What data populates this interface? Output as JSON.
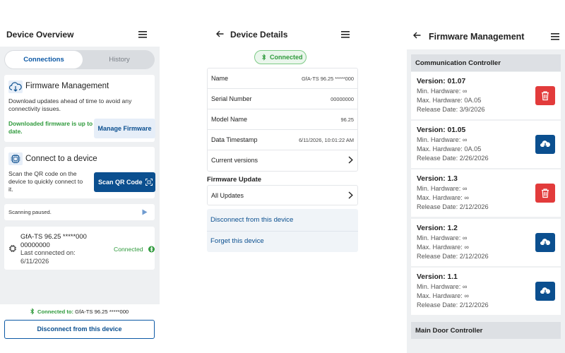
{
  "screen1": {
    "title": "Device Overview",
    "menu_icon": "hamburger-menu-icon",
    "tabs": [
      {
        "label": "Connections",
        "active": true
      },
      {
        "label": "History",
        "active": false
      }
    ],
    "firmware_card": {
      "icon": "cloud-download-icon",
      "title": "Firmware Management",
      "description": "Download updates ahead of time to avoid any connectivity issues.",
      "status": "Downloaded firmware is up to date.",
      "button": "Manage Firmware"
    },
    "connect_card": {
      "icon": "chip-icon",
      "title": "Connect to a device",
      "description": "Scan the QR code on the device to quickly connect to it.",
      "button": "Scan QR Code"
    },
    "scanning": {
      "text": "Scanning paused.",
      "icon": "play-icon"
    },
    "device": {
      "name": "GfA-TS 96.25 *****000",
      "serial": "00000000",
      "last_connected": "Last connected on: 6/11/2026",
      "status": "Connected"
    },
    "footer": {
      "connected_label": "Connected to:",
      "connected_device": "GfA-TS 96.25 *****000",
      "button": "Disconnect from this device"
    }
  },
  "screen2": {
    "title": "Device Details",
    "status_pill": "Connected",
    "rows": [
      {
        "label": "Name",
        "value": "GfA-TS 96.25 *****000"
      },
      {
        "label": "Serial Number",
        "value": "00000000"
      },
      {
        "label": "Model Name",
        "value": "96.25"
      },
      {
        "label": "Data Timestamp",
        "value": "6/11/2026, 10:01:22 AM"
      },
      {
        "label": "Current versions",
        "value": ""
      }
    ],
    "firmware_section": "Firmware Update",
    "all_updates": "All Updates",
    "actions": {
      "disconnect": "Disconnect from this device",
      "forget": "Forget this device"
    }
  },
  "screen3": {
    "title": "Firmware Management",
    "groups": [
      {
        "name": "Communication Controller",
        "versions": [
          {
            "version": "Version: 01.07",
            "min": "Min. Hardware: ∞",
            "max": "Max. Hardware: 0A.05",
            "date": "Release Date: 3/9/2026",
            "action": "delete"
          },
          {
            "version": "Version: 01.05",
            "min": "Min. Hardware: ∞",
            "max": "Max. Hardware: 0A.05",
            "date": "Release Date: 2/26/2026",
            "action": "download"
          },
          {
            "version": "Version: 1.3",
            "min": "Min. Hardware: ∞",
            "max": "Max. Hardware: ∞",
            "date": "Release Date: 2/12/2026",
            "action": "delete"
          },
          {
            "version": "Version: 1.2",
            "min": "Min. Hardware: ∞",
            "max": "Max. Hardware: ∞",
            "date": "Release Date: 2/12/2026",
            "action": "download"
          },
          {
            "version": "Version: 1.1",
            "min": "Min. Hardware: ∞",
            "max": "Max. Hardware: ∞",
            "date": "Release Date: 2/12/2026",
            "action": "download"
          }
        ]
      },
      {
        "name": "Main Door Controller",
        "versions": []
      }
    ]
  },
  "colors": {
    "primary": "#0b4f8f",
    "success": "#2f9a3c",
    "danger": "#e23b3b",
    "background": "#eef0f2"
  }
}
